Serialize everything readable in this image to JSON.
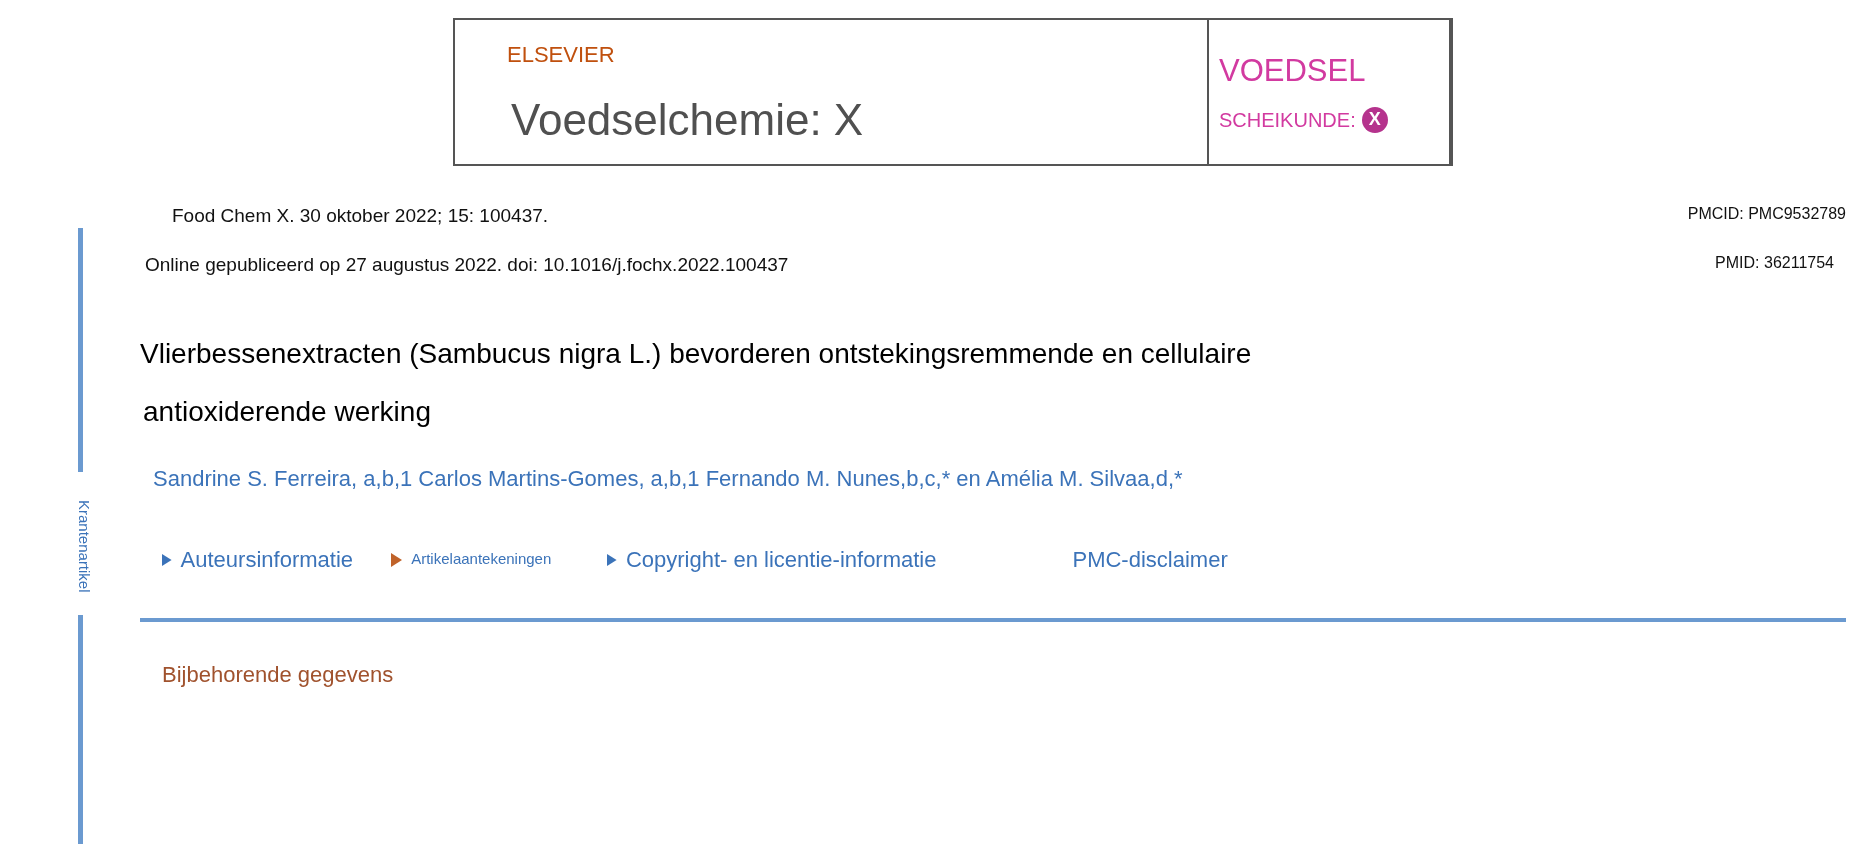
{
  "banner": {
    "publisher": "ELSEVIER",
    "journal": "Voedselchemie: X",
    "cover_title": "VOEDSEL",
    "cover_subtitle": "SCHEIKUNDE:",
    "cover_badge": "X"
  },
  "sidebar": {
    "label": "Krantenartikel"
  },
  "citation": {
    "source": "Food Chem X. 30 oktober 2022; 15: 100437.",
    "pmcid": "PMCID: PMC9532789",
    "online": "Online gepubliceerd op 27 augustus 2022. doi: 10.1016/j.fochx.2022.100437",
    "pmid": "PMID: 36211754"
  },
  "title_lines": [
    "Vlierbessenextracten (Sambucus nigra L.) bevorderen ontstekingsremmende en cellulaire",
    "antioxiderende werking"
  ],
  "authors": "Sandrine S. Ferreira, a,b,1 Carlos Martins-Gomes, a,b,1 Fernando M. Nunes,b,c,* en Amélia M. Silvaa,d,*",
  "links": [
    {
      "label": "Auteursinformatie",
      "kind": "section"
    },
    {
      "label": "Artikelaantekeningen",
      "kind": "notes"
    },
    {
      "label": "Copyright- en licentie-informatie",
      "kind": "section"
    },
    {
      "label": "PMC-disclaimer",
      "kind": "link"
    }
  ],
  "supplementary": "Bijbehorende gegevens"
}
